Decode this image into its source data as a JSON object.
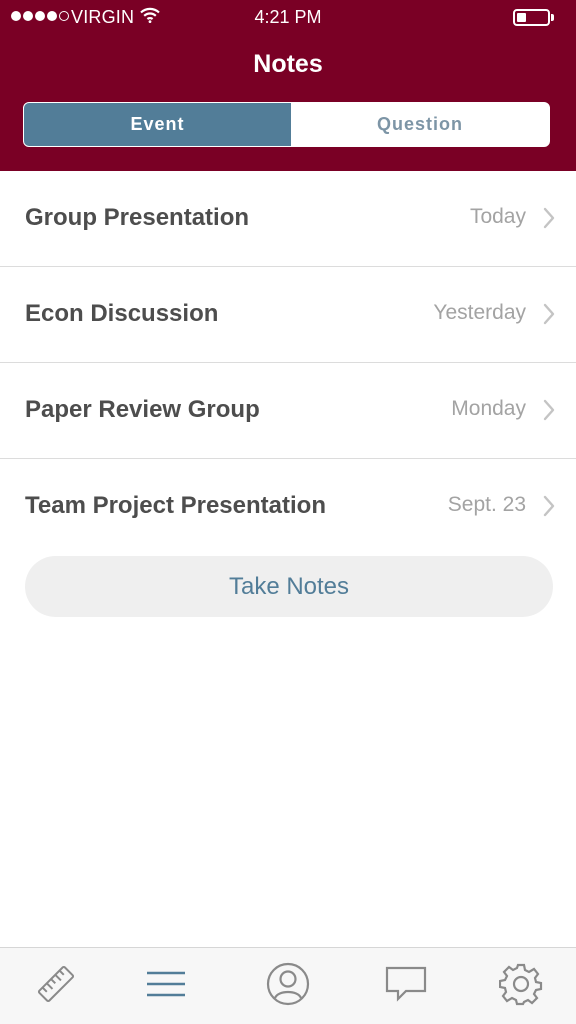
{
  "status_bar": {
    "carrier": "VIRGIN",
    "time": "4:21 PM",
    "signal_icon": "signal-dots-icon",
    "wifi_icon": "wifi-icon",
    "battery_icon": "battery-icon",
    "battery_level": 0.3
  },
  "header": {
    "title": "Notes",
    "background_color": "#7a0025"
  },
  "segmented_control": {
    "selected": "Event",
    "segments": [
      "Event",
      "Question"
    ],
    "active_color": "#527d98"
  },
  "notes": [
    {
      "title": "Group Presentation",
      "date": "Today"
    },
    {
      "title": "Econ Discussion",
      "date": "Yesterday"
    },
    {
      "title": "Paper Review Group",
      "date": "Monday"
    },
    {
      "title": "Team Project Presentation",
      "date": "Sept. 23"
    }
  ],
  "take_notes_button": {
    "label": "Take Notes"
  },
  "tab_bar": {
    "items": [
      {
        "icon": "ruler-icon"
      },
      {
        "icon": "menu-icon",
        "selected": true
      },
      {
        "icon": "profile-icon"
      },
      {
        "icon": "chat-icon"
      },
      {
        "icon": "settings-gear-icon"
      }
    ],
    "active_color": "#527d98",
    "inactive_color": "#8a8a8a"
  }
}
